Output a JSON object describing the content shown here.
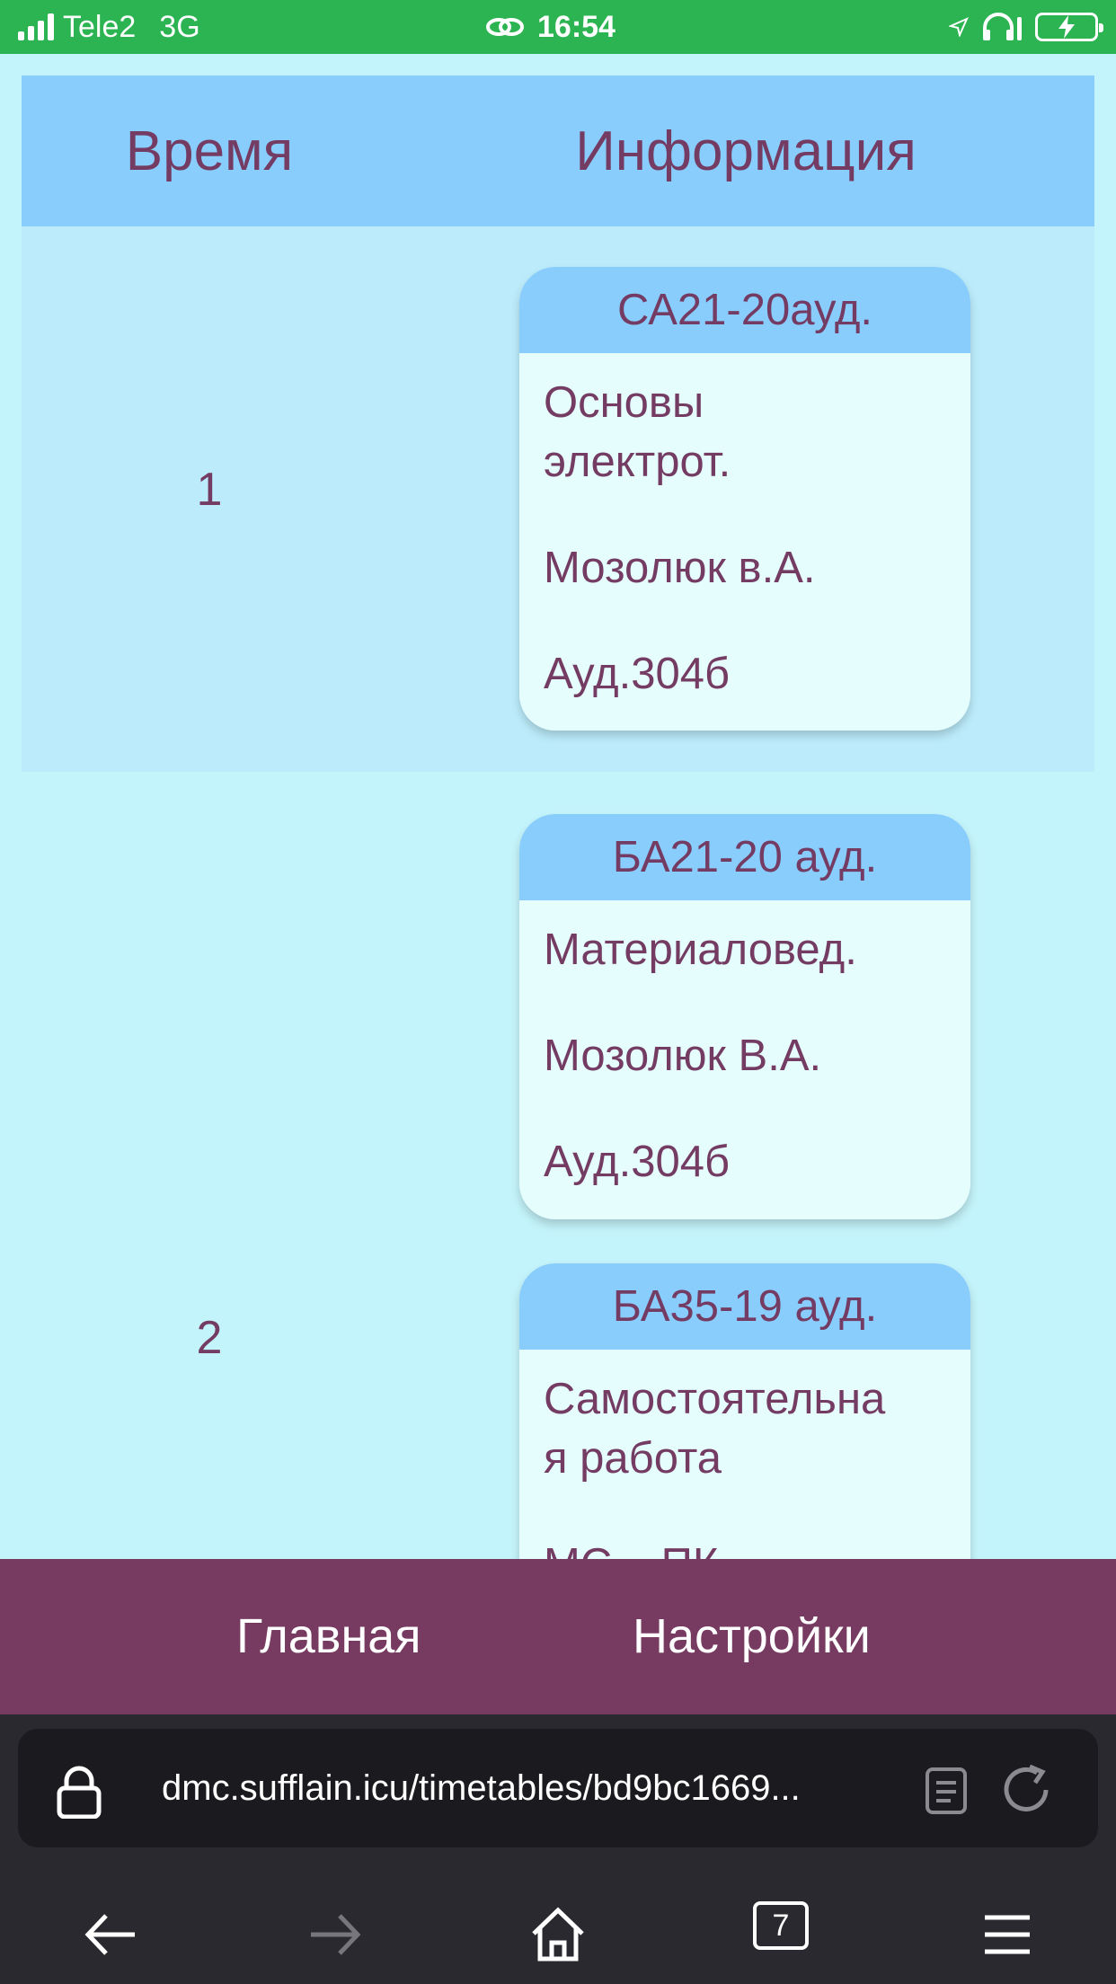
{
  "status_bar": {
    "carrier": "Tele2",
    "network": "3G",
    "time": "16:54"
  },
  "table": {
    "headers": {
      "time": "Время",
      "info": "Информация"
    },
    "rows": [
      {
        "number": "1",
        "cards": [
          {
            "group": "СА21-20ауд.",
            "subject_line1": "Основы",
            "subject_line2": "электрот.",
            "teacher": "Мозолюк в.А.",
            "room": "Ауд.304б"
          }
        ]
      },
      {
        "number": "2",
        "cards": [
          {
            "group": "БА21-20 ауд.",
            "subject_line1": "Материаловед.",
            "teacher": "Мозолюк В.А.",
            "room": "Ауд.304б"
          },
          {
            "group": "БА35-19 ауд.",
            "subject_line1": "Самостоятельна",
            "subject_line2": "я работа",
            "teacher_partial": "МС... ПК..."
          }
        ]
      }
    ]
  },
  "bottom_nav": {
    "home": "Главная",
    "settings": "Настройки"
  },
  "browser": {
    "url": "dmc.sufflain.icu/timetables/bd9bc1669...",
    "tab_count": "7"
  },
  "colors": {
    "status_green": "#2bb451",
    "header_blue": "#89cdfd",
    "text_plum": "#743c63",
    "nav_plum": "#773a61"
  }
}
